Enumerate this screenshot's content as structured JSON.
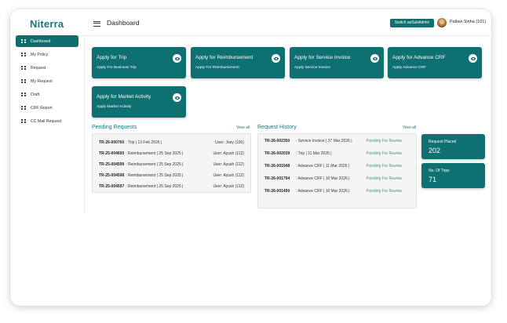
{
  "header": {
    "logo": "Niterra",
    "title": "Dashboard",
    "switch_label": "Switch asSubAdmin",
    "user": "Pallavi Sinha (101)"
  },
  "sidebar": {
    "items": [
      {
        "label": "Dashboard",
        "active": true
      },
      {
        "label": "My Policy"
      },
      {
        "label": "Request"
      },
      {
        "label": "My Request"
      },
      {
        "label": "Draft"
      },
      {
        "label": "CRF Report"
      },
      {
        "label": "CC Mail Request"
      }
    ]
  },
  "cards": [
    {
      "title": "Apply for Trip",
      "sub": "Apply For Business Trip"
    },
    {
      "title": "Apply for Reimbursement",
      "sub": "Apply For Reimbursement"
    },
    {
      "title": "Apply for Service Invoice",
      "sub": "Apply Service Invoice"
    },
    {
      "title": "Apply for Advance CRF",
      "sub": "Apply Advance CRF"
    },
    {
      "title": "Apply for Market Activity",
      "sub": "Apply Market Activity"
    }
  ],
  "pending": {
    "title": "Pending Requests",
    "view_all": "View all",
    "rows": [
      {
        "id": "TR-26-000760",
        "text": ": Trip | 13 Feb 2026 |",
        "user": "User: Joey (100)"
      },
      {
        "id": "TR-25-004600",
        "text": ": Reimbursement | 25 Sep 2025 |",
        "user": "User: Ayush (112)"
      },
      {
        "id": "TR-25-004599",
        "text": ": Reimbursement | 25 Sep 2025 |",
        "user": "User: Ayush (112)"
      },
      {
        "id": "TR-25-004598",
        "text": ": Reimbursement | 25 Sep 2025 |",
        "user": "User: Ayush (112)"
      },
      {
        "id": "TR-25-004597",
        "text": ": Reimbursement | 25 Sep 2025 |",
        "user": "User: Ayush (112)"
      }
    ]
  },
  "history": {
    "title": "Request History",
    "view_all": "View all",
    "rows": [
      {
        "id": "TR-26-002350",
        "text": ": Service Invoice | 27 Mar 2026 |",
        "status": "Pending For Review"
      },
      {
        "id": "TR-26-002039",
        "text": ": Trip | 11 Mar 2026 |",
        "status": "Pending For Review"
      },
      {
        "id": "TR-26-001948",
        "text": ": Advance CRF | 11 Mar 2026 |",
        "status": "Pending For Review"
      },
      {
        "id": "TR-26-001794",
        "text": ": Advance CRF | 10 Mar 2026 |",
        "status": "Pending For Review"
      },
      {
        "id": "TR-26-001490",
        "text": ": Advance CRF | 10 Mar 2026 |",
        "status": "Pending For Review"
      }
    ]
  },
  "stats": [
    {
      "label": "Request Placed",
      "value": "202"
    },
    {
      "label": "No. Of Trips",
      "value": "71"
    }
  ],
  "colors": {
    "brand": "#0e7070",
    "status_pending": "#3aa063"
  }
}
